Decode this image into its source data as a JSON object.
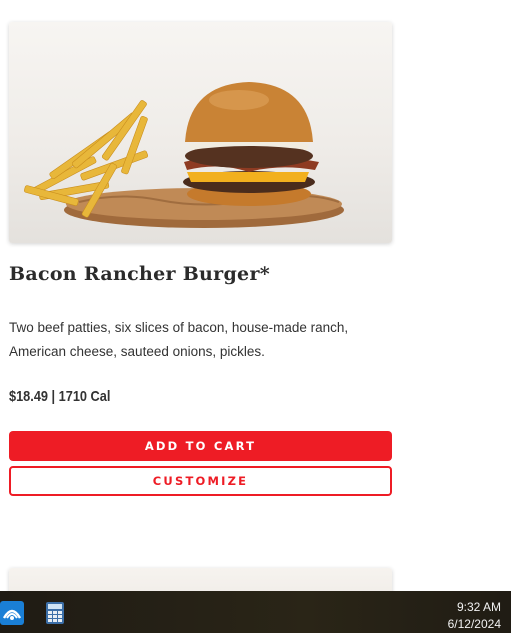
{
  "item": {
    "title": "Bacon Rancher Burger*",
    "description": "Two beef patties, six slices of bacon, house-made ranch, American cheese, sauteed onions, pickles.",
    "price_cal": "$18.49 | 1710 Cal"
  },
  "buttons": {
    "add_to_cart": "ADD TO CART",
    "customize": "CUSTOMIZE"
  },
  "taskbar": {
    "time": "9:32 AM",
    "date": "6/12/2024",
    "icons": [
      "app-start-icon",
      "calculator-icon"
    ]
  },
  "colors": {
    "accent": "#ee1c25",
    "text": "#2b2b2b",
    "taskbar": "#2a2517"
  }
}
